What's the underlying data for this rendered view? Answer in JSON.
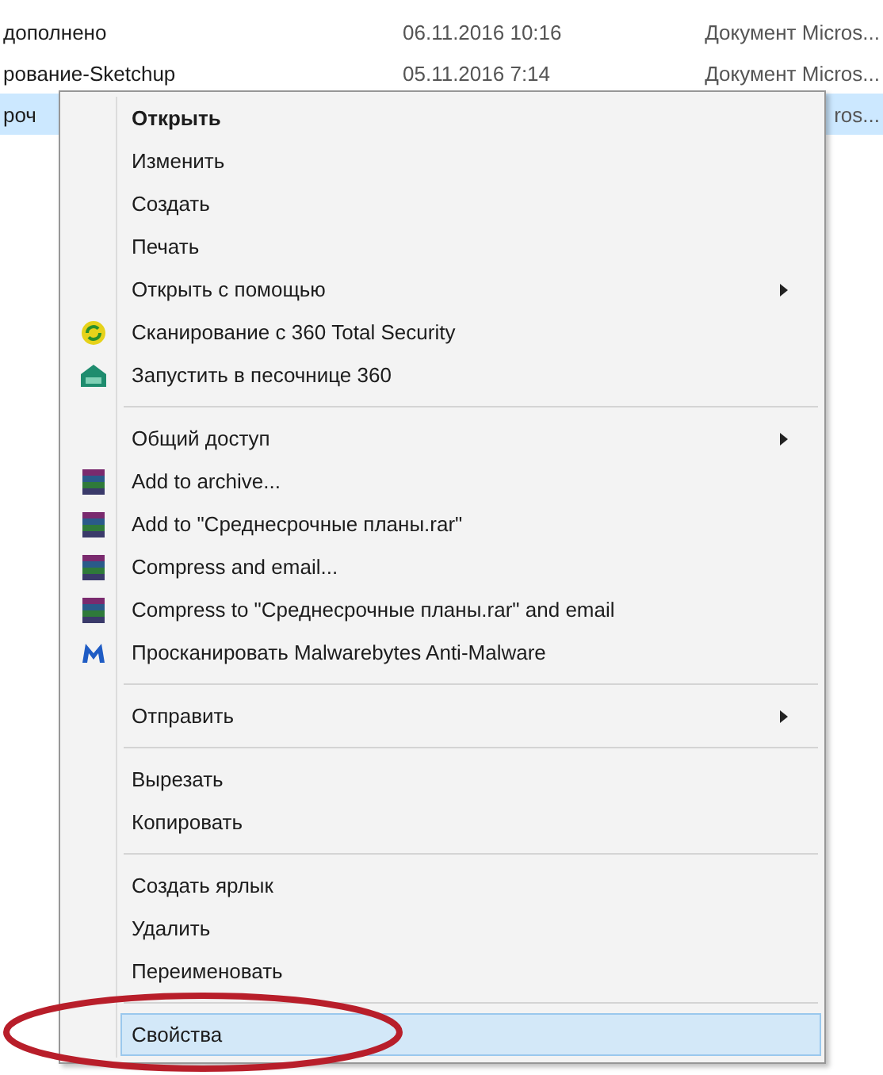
{
  "files": [
    {
      "name": "дополнено",
      "date": "06.11.2016 10:16",
      "type": "Документ Micros...",
      "selected": false
    },
    {
      "name": "рование-Sketchup",
      "date": "05.11.2016 7:14",
      "type": "Документ Micros...",
      "selected": false
    },
    {
      "name": "роч",
      "type": "ros...",
      "selected": true
    }
  ],
  "context_menu": {
    "groups": [
      [
        {
          "label": "Открыть",
          "default": true,
          "submenu": false,
          "highlighted": false,
          "kind": "plain"
        },
        {
          "label": "Изменить",
          "default": false,
          "submenu": false,
          "highlighted": false,
          "kind": "plain"
        },
        {
          "label": "Создать",
          "default": false,
          "submenu": false,
          "highlighted": false,
          "kind": "plain"
        },
        {
          "label": "Печать",
          "default": false,
          "submenu": false,
          "highlighted": false,
          "kind": "plain"
        },
        {
          "label": "Открыть с помощью",
          "default": false,
          "submenu": true,
          "highlighted": false,
          "kind": "plain"
        },
        {
          "label": "Сканирование с 360 Total Security",
          "default": false,
          "submenu": false,
          "highlighted": false,
          "kind": "scan"
        },
        {
          "label": "Запустить в песочнице 360",
          "default": false,
          "submenu": false,
          "highlighted": false,
          "kind": "sandbox"
        }
      ],
      [
        {
          "label": "Общий доступ",
          "default": false,
          "submenu": true,
          "highlighted": false,
          "kind": "plain"
        },
        {
          "label": "Add to archive...",
          "default": false,
          "submenu": false,
          "highlighted": false,
          "kind": "archive"
        },
        {
          "label": "Add to \"Среднесрочные планы.rar\"",
          "default": false,
          "submenu": false,
          "highlighted": false,
          "kind": "archive"
        },
        {
          "label": "Compress and email...",
          "default": false,
          "submenu": false,
          "highlighted": false,
          "kind": "archive"
        },
        {
          "label": "Compress to \"Среднесрочные планы.rar\" and email",
          "default": false,
          "submenu": false,
          "highlighted": false,
          "kind": "archive"
        },
        {
          "label": "Просканировать Malwarebytes Anti-Malware",
          "default": false,
          "submenu": false,
          "highlighted": false,
          "kind": "malware"
        }
      ],
      [
        {
          "label": "Отправить",
          "default": false,
          "submenu": true,
          "highlighted": false,
          "kind": "plain"
        }
      ],
      [
        {
          "label": "Вырезать",
          "default": false,
          "submenu": false,
          "highlighted": false,
          "kind": "plain"
        },
        {
          "label": "Копировать",
          "default": false,
          "submenu": false,
          "highlighted": false,
          "kind": "plain"
        }
      ],
      [
        {
          "label": "Создать ярлык",
          "default": false,
          "submenu": false,
          "highlighted": false,
          "kind": "plain"
        },
        {
          "label": "Удалить",
          "default": false,
          "submenu": false,
          "highlighted": false,
          "kind": "plain"
        },
        {
          "label": "Переименовать",
          "default": false,
          "submenu": false,
          "highlighted": false,
          "kind": "plain"
        }
      ],
      [
        {
          "label": "Свойства",
          "default": false,
          "submenu": false,
          "highlighted": true,
          "kind": "plain"
        }
      ]
    ]
  }
}
